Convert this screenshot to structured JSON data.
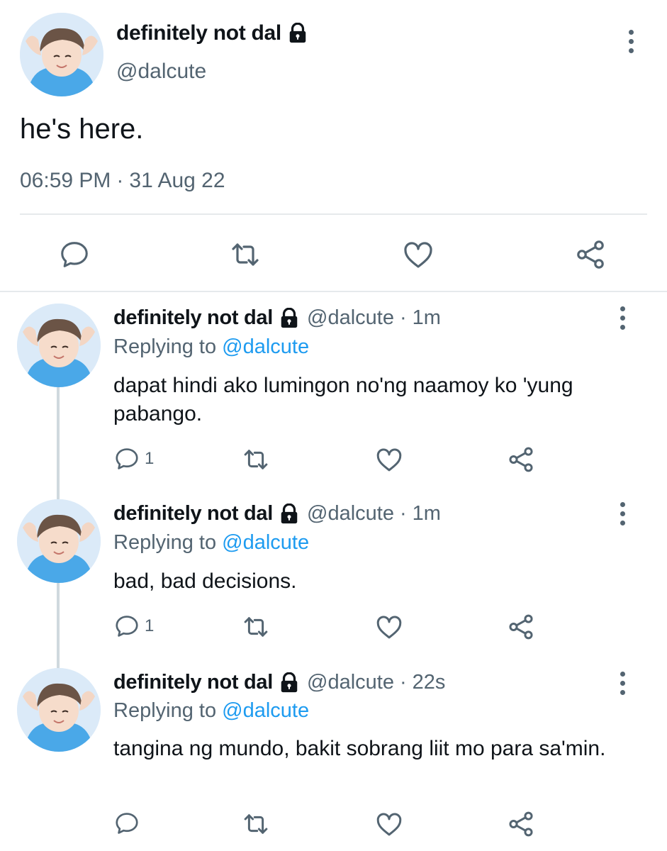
{
  "main_tweet": {
    "display_name": "definitely not dal",
    "handle": "@dalcute",
    "text": "he's here.",
    "time": "06:59 PM",
    "separator": "·",
    "date": "31 Aug 22"
  },
  "replies": [
    {
      "display_name": "definitely not dal",
      "handle": "@dalcute",
      "dot": "·",
      "time": "1m",
      "replying_prefix": "Replying to",
      "replying_to": "@dalcute",
      "text": "dapat hindi ako lumingon no'ng naamoy ko 'yung pabango.",
      "reply_count": "1"
    },
    {
      "display_name": "definitely not dal",
      "handle": "@dalcute",
      "dot": "·",
      "time": "1m",
      "replying_prefix": "Replying to",
      "replying_to": "@dalcute",
      "text": "bad, bad decisions.",
      "reply_count": "1"
    },
    {
      "display_name": "definitely not dal",
      "handle": "@dalcute",
      "dot": "·",
      "time": "22s",
      "replying_prefix": "Replying to",
      "replying_to": "@dalcute",
      "text": "tangina ng mundo, bakit sobrang liit mo para sa'min.",
      "reply_count": ""
    }
  ],
  "icons": {
    "lock": "lock-icon",
    "more": "more-vertical-icon",
    "reply": "reply-icon",
    "retweet": "retweet-icon",
    "like": "heart-icon",
    "share": "share-icon"
  },
  "colors": {
    "text": "#0f1419",
    "secondary": "#536471",
    "link": "#1d9bf0",
    "divider": "#e6e9ec",
    "thread_line": "#cfd9de"
  }
}
